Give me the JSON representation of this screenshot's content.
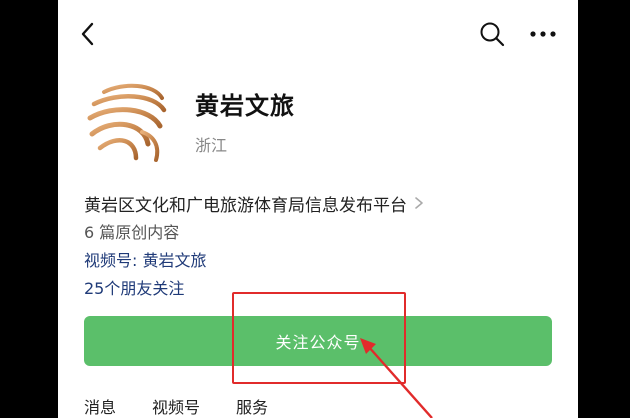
{
  "header": {
    "back_icon": "chevron-left-icon",
    "search_icon": "search-icon",
    "more_icon": "more-dots-icon"
  },
  "account": {
    "name": "黄岩文旅",
    "region": "浙江",
    "description": "黄岩区文化和广电旅游体育局信息发布平台",
    "original_count": "6 篇原创内容",
    "video_account": "视频号: 黄岩文旅",
    "friends_following": "25个朋友关注",
    "follow_button": "关注公众号"
  },
  "tabs": [
    "消息",
    "视频号",
    "服务"
  ],
  "colors": {
    "follow_green": "#5bbf6a",
    "annotation_red": "#e12b2b",
    "link_blue": "#1f3a78"
  }
}
